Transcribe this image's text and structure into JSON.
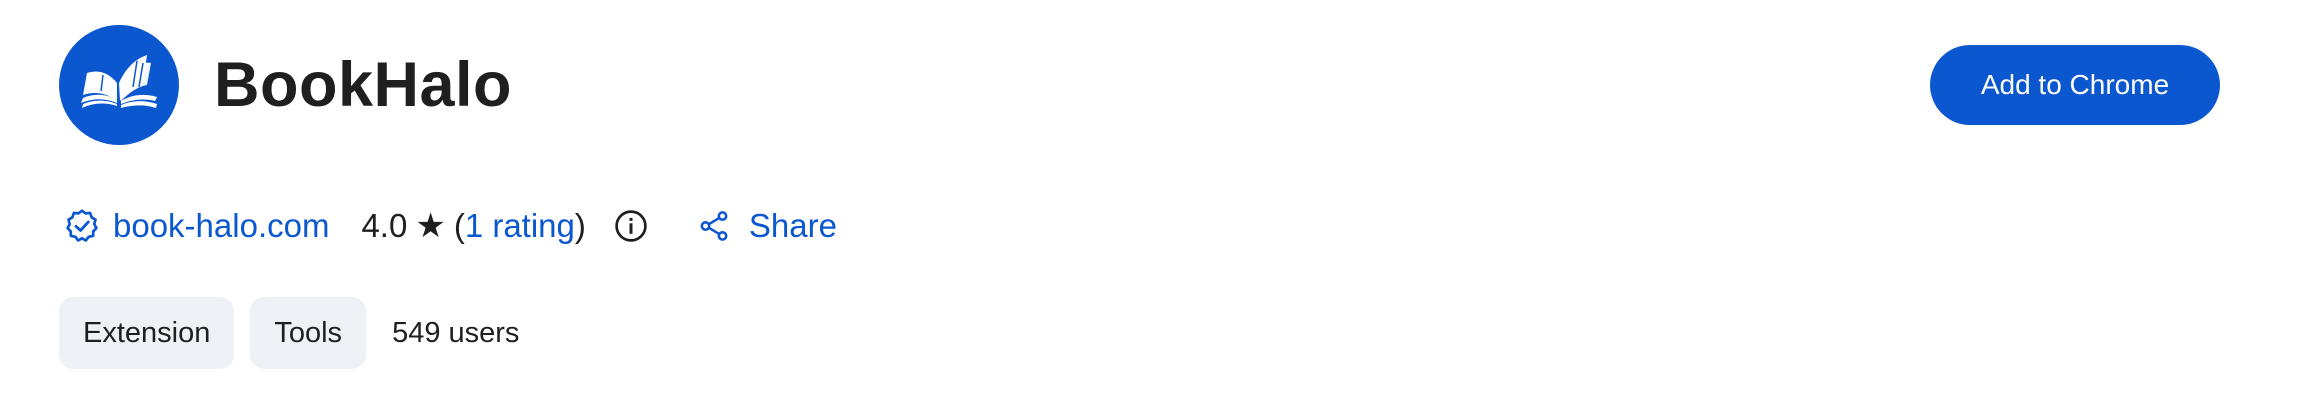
{
  "extension": {
    "name": "BookHalo",
    "logo_icon": "open-book-icon",
    "brand_color": "#0b57d0"
  },
  "actions": {
    "add_label": "Add to Chrome"
  },
  "meta": {
    "publisher_icon": "verified-badge-icon",
    "publisher": "book-halo.com",
    "rating_value": "4.0",
    "rating_star": "★",
    "rating_open": "(",
    "rating_count": "1 rating",
    "rating_close": ")",
    "info_icon": "info-icon",
    "share_icon": "share-icon",
    "share_label": "Share"
  },
  "tags": {
    "category": "Extension",
    "subcategory": "Tools",
    "users": "549 users"
  },
  "colors": {
    "accent": "#0b57d0",
    "chip_bg": "#eef1f6",
    "text": "#1f1f1f"
  }
}
